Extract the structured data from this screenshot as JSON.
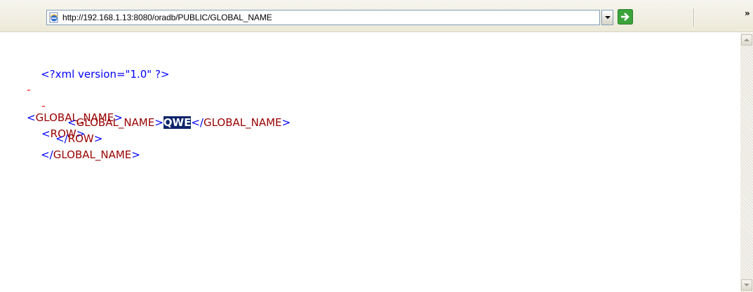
{
  "address_bar": {
    "url": "http://192.168.1.13:8080/oradb/PUBLIC/GLOBAL_NAME",
    "page_icon": "ie-page-icon",
    "dropdown_icon": "dropdown-arrow-icon",
    "go_icon": "go-arrow-icon",
    "overflow_chevron": "»"
  },
  "xml": {
    "declaration": "<?xml version=\"1.0\" ?>",
    "root_toggle": "-",
    "root_open_lt": "<",
    "root_open_name": "GLOBAL_NAME",
    "root_open_gt": ">",
    "row_toggle": "-",
    "row_open_lt": "<",
    "row_open_name": "ROW",
    "row_open_gt": ">",
    "field_open_lt": "<",
    "field_open_name": "GLOBAL_NAME",
    "field_open_gt": ">",
    "field_value": "QWE",
    "field_close_lt": "</",
    "field_close_name": "GLOBAL_NAME",
    "field_close_gt": ">",
    "row_close_lt": "</",
    "row_close_name": "ROW",
    "row_close_gt": ">",
    "root_close_lt": "</",
    "root_close_name": "GLOBAL_NAME",
    "root_close_gt": ">"
  },
  "colors": {
    "markup": "#0000ff",
    "tag_name": "#990000",
    "toggle": "#ff0000",
    "selection_bg": "#0a246a"
  }
}
